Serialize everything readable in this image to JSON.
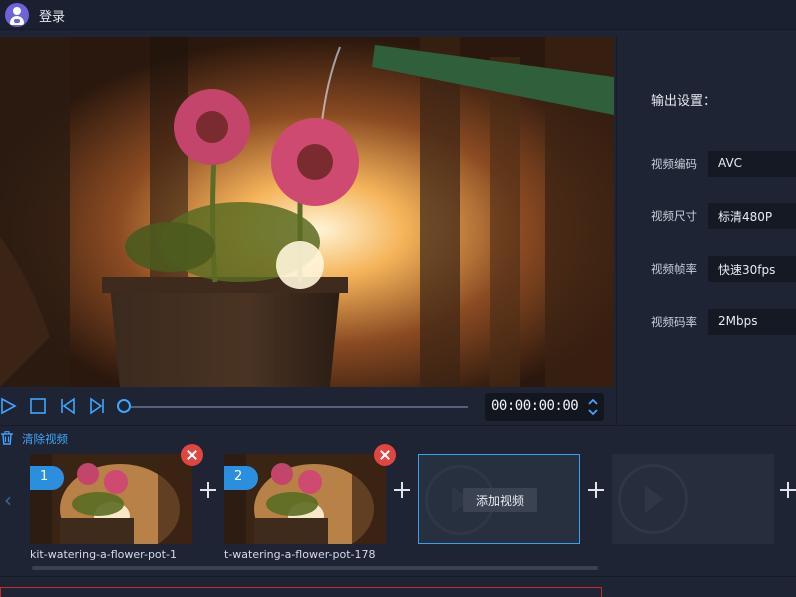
{
  "titlebar": {
    "login_label": "登录"
  },
  "player": {
    "timecode": "00:00:00:00",
    "progress": 0
  },
  "settings": {
    "title": "输出设置：",
    "rows": [
      {
        "label": "视频编码",
        "value": "AVC"
      },
      {
        "label": "视频尺寸",
        "value": "标清480P"
      },
      {
        "label": "视频帧率",
        "value": "快速30fps"
      },
      {
        "label": "视频码率",
        "value": "2Mbps"
      }
    ]
  },
  "clips_toolbar": {
    "clear_label": "清除视频"
  },
  "clips": [
    {
      "index": "1",
      "name": "kit-watering-a-flower-pot-1"
    },
    {
      "index": "2",
      "name": "t-watering-a-flower-pot-178"
    }
  ],
  "add_slot": {
    "label": "添加视频"
  },
  "colors": {
    "accent": "#3ea6ff",
    "badge": "#2b8fe0",
    "delete": "#e0453f",
    "panel": "#1e2433",
    "alert_border": "#c62a2a"
  }
}
